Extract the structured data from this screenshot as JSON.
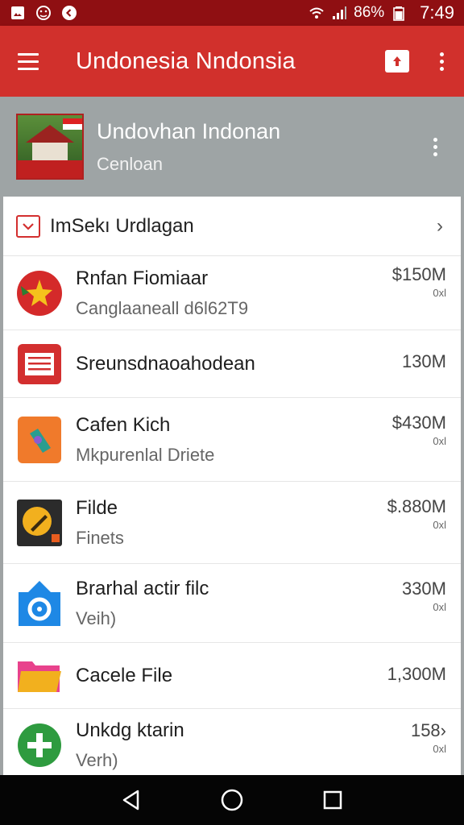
{
  "status_bar": {
    "battery_percent": "86%",
    "time": "7:49"
  },
  "app_bar": {
    "title": "Undonesia Nndonsia"
  },
  "header": {
    "title": "Undovhan Indonan",
    "subtitle": "Cenloan"
  },
  "section": {
    "label": "ImSekı Urdlagan"
  },
  "files": [
    {
      "title": "Rnfan Fiomiaar",
      "subtitle": "Canglaaneall d6l62T9",
      "size": "$150M",
      "unit": "0хl",
      "icon": "star-badge-icon"
    },
    {
      "title": "Sreunsdnaoahodean",
      "subtitle": "",
      "size": "130M",
      "unit": "",
      "icon": "document-icon"
    },
    {
      "title": "Cafen Kich",
      "subtitle": "Mkpurenlal Driete",
      "size": "$430M",
      "unit": "0хl",
      "icon": "tool-icon"
    },
    {
      "title": "Filde",
      "subtitle": "Finets",
      "size": "$.880M",
      "unit": "0хl",
      "icon": "pencil-icon"
    },
    {
      "title": "Brarhal actir filc",
      "subtitle": "Veih)",
      "size": "330M",
      "unit": "0хl",
      "icon": "camera-icon"
    },
    {
      "title": "Cacele File",
      "subtitle": "",
      "size": "1,300M",
      "unit": "",
      "icon": "folder-icon"
    },
    {
      "title": "Unkdg ktarin",
      "subtitle": "Verh)",
      "size": "158›",
      "unit": "0хl",
      "icon": "add-circle-icon"
    }
  ],
  "colors": {
    "app_bar": "#d1302c",
    "status_bar": "#8f0f12",
    "header_bg": "#9ea4a5",
    "nav_bar": "#050505"
  }
}
